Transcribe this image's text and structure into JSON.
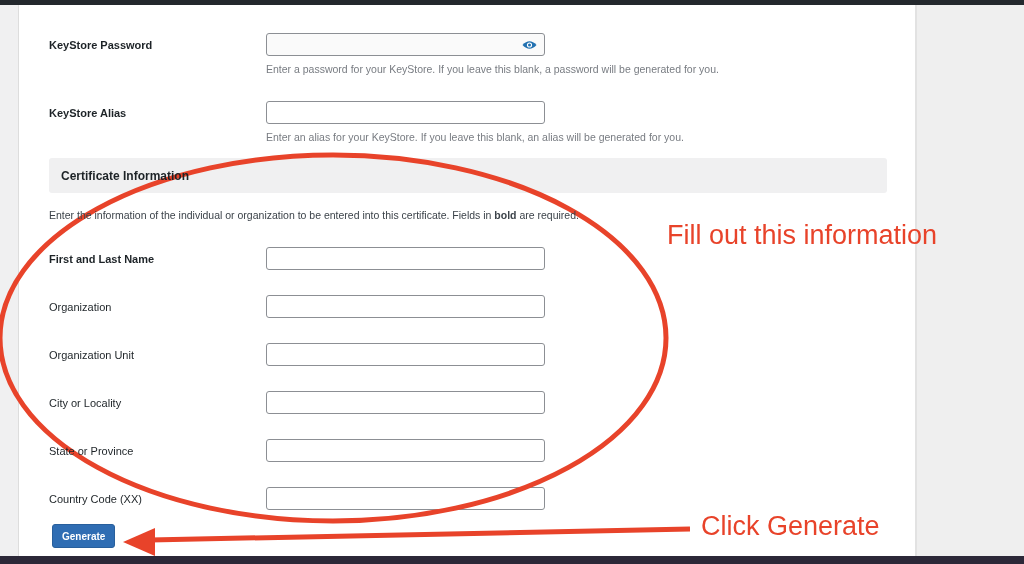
{
  "keystore_fields": [
    {
      "label": "KeyStore Password",
      "kind": "password",
      "required": true,
      "help": "Enter a password for your KeyStore. If you leave this blank, a password will be generated for you."
    },
    {
      "label": "KeyStore Alias",
      "kind": "text",
      "required": true,
      "help": "Enter an alias for your KeyStore. If you leave this blank, an alias will be generated for you."
    }
  ],
  "section": {
    "title": "Certificate Information",
    "intro": "Enter the information of the individual or organization to be entered into this certificate. Fields in **bold** are required."
  },
  "certificate_fields": [
    {
      "label": "First and Last Name",
      "required": true
    },
    {
      "label": "Organization",
      "required": false
    },
    {
      "label": "Organization Unit",
      "required": false
    },
    {
      "label": "City or Locality",
      "required": false
    },
    {
      "label": "State or Province",
      "required": false
    },
    {
      "label": "Country Code (XX)",
      "required": false
    }
  ],
  "button": "Generate",
  "annotations": [
    {
      "kind": "callout",
      "text": "Fill out this information"
    },
    {
      "kind": "pointer",
      "text": "Click Generate"
    }
  ]
}
